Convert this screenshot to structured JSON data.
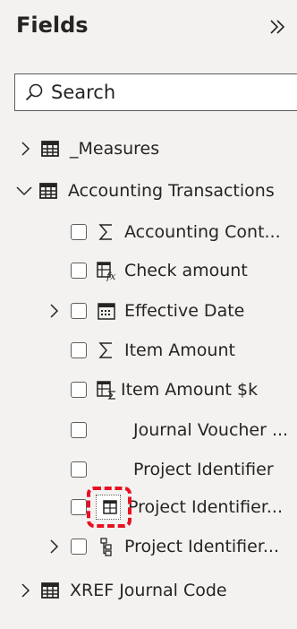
{
  "pane": {
    "title": "Fields",
    "collapse_icon": "double-chevron-right-icon"
  },
  "search": {
    "placeholder": "Search",
    "value": ""
  },
  "tables": [
    {
      "name": "_Measures",
      "expanded": false
    },
    {
      "name": "Accounting Transactions",
      "expanded": true,
      "fields": [
        {
          "label": "Accounting Cont...",
          "icon": "sigma-icon"
        },
        {
          "label": "Check amount",
          "icon": "calculated-column-icon"
        },
        {
          "label": "Effective Date",
          "icon": "calendar-icon",
          "expandable": true
        },
        {
          "label": "Item Amount",
          "icon": "sigma-icon"
        },
        {
          "label": "Item Amount $k",
          "icon": "calculated-sigma-icon"
        },
        {
          "label": "Journal Voucher ...",
          "icon": ""
        },
        {
          "label": "Project Identifier",
          "icon": ""
        },
        {
          "label": "Project Identifier...",
          "icon": "table-small-icon",
          "highlighted": true
        },
        {
          "label": "Project Identifier...",
          "icon": "hierarchy-icon",
          "expandable": true
        }
      ]
    },
    {
      "name": "XREF Journal Code",
      "expanded": false
    }
  ],
  "colors": {
    "background": "#f3f2f1",
    "text": "#252423",
    "highlight": "#e81123"
  }
}
